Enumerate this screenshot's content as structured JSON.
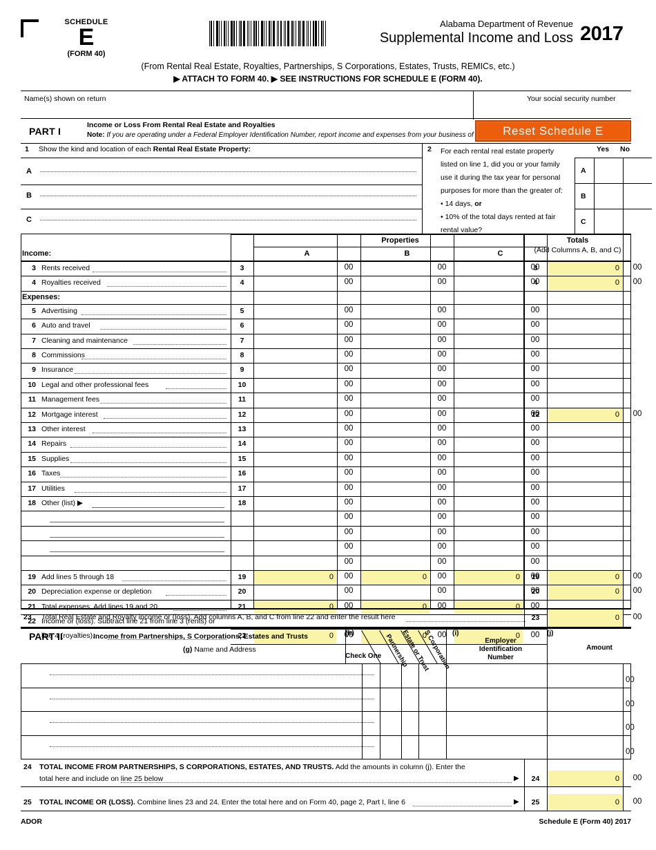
{
  "header": {
    "schedule_word": "SCHEDULE",
    "schedule_letter": "E",
    "schedule_form": "(FORM 40)",
    "agency": "Alabama Department of Revenue",
    "form_title": "Supplemental Income and Loss",
    "year": "2017",
    "subtitle": "(From Rental Real Estate, Royalties, Partnerships, S Corporations, Estates, Trusts, REMICs, etc.)",
    "instructions": "▶ ATTACH TO FORM 40.  ▶ SEE INSTRUCTIONS FOR SCHEDULE E (FORM 40)."
  },
  "identity": {
    "name_label": "Name(s) shown on return",
    "ssn_label": "Your social security number"
  },
  "part1": {
    "label": "PART I",
    "title": "Income or Loss From Rental Real Estate and Royalties",
    "note_prefix": "Note:",
    "note_text": "If you are operating under a Federal Employer Identification Number, report income and expenses from your business of ren",
    "reset_button": "Reset Schedule E",
    "accent_color": "#ED5E0C",
    "highlight_color": "#FAF4A8"
  },
  "line1": {
    "number": "1",
    "text_prefix": "Show the kind and location of each ",
    "text_bold": "Rental Real Estate Property:",
    "rows": [
      "A",
      "B",
      "C"
    ]
  },
  "line2": {
    "number": "2",
    "lines": [
      "For each rental real estate property",
      "listed on line 1, did you or your family",
      "use it during the tax year for personal",
      "purposes for more than the greater of:",
      "• 14 days, or",
      "• 10% of the total days rented at fair",
      "   rental value?"
    ],
    "yes": "Yes",
    "no": "No",
    "rows": [
      "A",
      "B",
      "C"
    ]
  },
  "table": {
    "properties_header": "Properties",
    "totals_header": "Totals",
    "totals_sub": "(Add Columns A, B, and C)",
    "col_a": "A",
    "col_b": "B",
    "col_c": "C",
    "income_label": "Income:",
    "expenses_label": "Expenses:",
    "cents": "00",
    "zero": "0",
    "rows": [
      {
        "num": "3",
        "label": "Rents received",
        "totals": "0",
        "has_total": true,
        "yellow_cols": false
      },
      {
        "num": "4",
        "label": "Royalties received",
        "totals": "0",
        "has_total": true,
        "yellow_cols": false
      },
      {
        "num": "5",
        "label": "Advertising",
        "totals": "",
        "has_total": false,
        "yellow_cols": false
      },
      {
        "num": "6",
        "label": "Auto and travel ",
        "totals": "",
        "has_total": false,
        "yellow_cols": false
      },
      {
        "num": "7",
        "label": "Cleaning and maintenance ",
        "totals": "",
        "has_total": false,
        "yellow_cols": false
      },
      {
        "num": "8",
        "label": "Commissions",
        "totals": "",
        "has_total": false,
        "yellow_cols": false
      },
      {
        "num": "9",
        "label": "Insurance",
        "totals": "",
        "has_total": false,
        "yellow_cols": false
      },
      {
        "num": "10",
        "label": "Legal and other professional fees ",
        "totals": "",
        "has_total": false,
        "yellow_cols": false
      },
      {
        "num": "11",
        "label": "Management fees ",
        "totals": "",
        "has_total": false,
        "yellow_cols": false
      },
      {
        "num": "12",
        "label": "Mortgage interest",
        "totals": "0",
        "has_total": true,
        "yellow_cols": false
      },
      {
        "num": "13",
        "label": "Other interest",
        "totals": "",
        "has_total": false,
        "yellow_cols": false
      },
      {
        "num": "14",
        "label": "Repairs ",
        "totals": "",
        "has_total": false,
        "yellow_cols": false
      },
      {
        "num": "15",
        "label": "Supplies",
        "totals": "",
        "has_total": false,
        "yellow_cols": false
      },
      {
        "num": "16",
        "label": "Taxes",
        "totals": "",
        "has_total": false,
        "yellow_cols": false
      },
      {
        "num": "17",
        "label": "Utilities",
        "totals": "",
        "has_total": false,
        "yellow_cols": false
      },
      {
        "num": "18",
        "label": "Other (list) ▶",
        "totals": "",
        "has_total": false,
        "yellow_cols": false
      }
    ],
    "totals_rows": [
      {
        "num": "19",
        "label": "Add lines 5 through 18",
        "totals": "0",
        "has_total": true,
        "cols_value": "0"
      },
      {
        "num": "20",
        "label": "Depreciation expense or depletion ",
        "totals": "0",
        "has_total": true,
        "cols_value": ""
      },
      {
        "num": "21",
        "label": "Total expenses. Add lines 19 and 20 ",
        "totals": "",
        "has_total": false,
        "cols_value": "0"
      }
    ],
    "line22": {
      "num": "22",
      "line_a": "Income or (loss). Subtract line 21 from line 3 (rents) or",
      "line_b": "line 4 (royalties).",
      "cols_value": "0"
    },
    "line23": {
      "num": "23",
      "text": "Total Real Estate and Royalty income or (loss). Add columns A, B, and C from line 22 and enter the result here",
      "value": "0"
    }
  },
  "part2": {
    "label": "PART II",
    "title": "Income from Partnerships, S Corporations, Estates and Trusts",
    "col_g": "(g)",
    "col_g_label": "Name and Address",
    "col_h": "(h)",
    "check_one": "Check One",
    "type_partnership": "Partnership",
    "type_estate_trust": "Estate or Trust",
    "type_s_corp": "S Corporation",
    "col_i": "(i)",
    "col_i_label_1": "Employer",
    "col_i_label_2": "Identification",
    "col_i_label_3": "Number",
    "col_j": "(j)",
    "col_j_label": "Amount",
    "cents": "00",
    "row_count": 4
  },
  "line24": {
    "num": "24",
    "bold": "TOTAL INCOME FROM PARTNERSHIPS, S CORPORATIONS, ESTATES, AND TRUSTS.",
    "rest": " Add the amounts in column (j). Enter the",
    "line2": "total here and include on line 25 below",
    "arrow": "▶",
    "value": "0",
    "cents": "00"
  },
  "line25": {
    "num": "25",
    "bold": "TOTAL INCOME OR (LOSS).",
    "rest": " Combine lines 23 and 24. Enter the total here and on Form 40, page 2, Part I, line 6",
    "arrow": "▶",
    "value": "0",
    "cents": "00"
  },
  "footer": {
    "left": "ADOR",
    "right": "Schedule E (Form 40) 2017"
  }
}
